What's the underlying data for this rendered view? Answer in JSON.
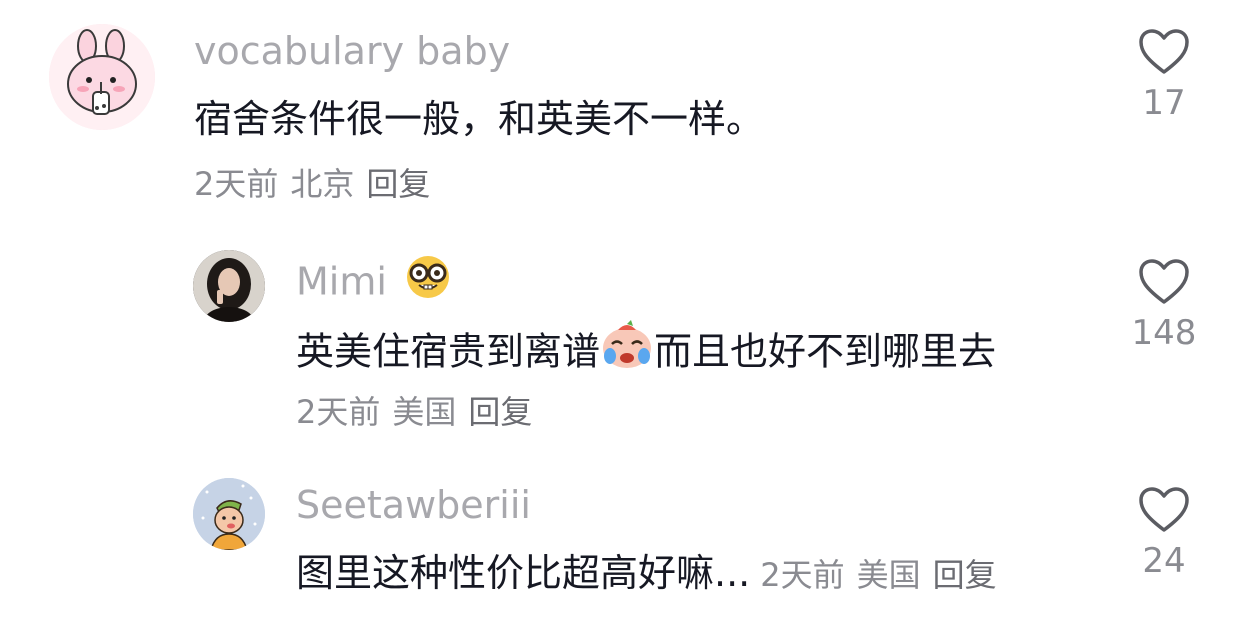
{
  "comments": [
    {
      "username": "vocabulary baby",
      "text": "宿舍条件很一般，和英美不一样。",
      "time": "2天前",
      "location": "北京",
      "reply_label": "回复",
      "likes": "17",
      "avatar_icon": "pink-bunny-avatar"
    },
    {
      "username": "Mimi",
      "username_emoji": "nerd-face-emoji",
      "text_before": "英美住宿贵到离谱",
      "text_emoji": "crying-face-emoji",
      "text_after": "而且也好不到哪里去",
      "time": "2天前",
      "location": "美国",
      "reply_label": "回复",
      "likes": "148",
      "avatar_icon": "dark-hair-photo-avatar"
    },
    {
      "username": "Seetawberiii",
      "text": "图里这种性价比超高好嘛...",
      "time": "2天前",
      "location": "美国",
      "reply_label": "回复",
      "likes": "24",
      "avatar_icon": "cartoon-character-avatar"
    }
  ],
  "colors": {
    "username": "#a8a8ad",
    "text": "#161823",
    "meta": "#8a8b91",
    "heart_stroke": "#5b5c62"
  }
}
